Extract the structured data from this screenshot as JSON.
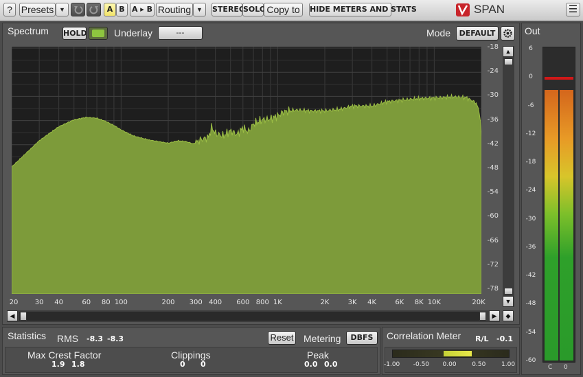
{
  "toolbar": {
    "help": "?",
    "presets": "Presets",
    "dropdown_glyph": "▼",
    "a": "A",
    "b": "B",
    "ab": "A ▸ B",
    "routing": "Routing",
    "stereo": "STEREO",
    "solo": "SOLO",
    "copy_to": "Copy to",
    "hide_meters": "HIDE METERS AND STATS",
    "logo": "SPAN",
    "menu_glyph": "☰"
  },
  "spectrum": {
    "title": "Spectrum",
    "hold": "HOLD",
    "underlay_label": "Underlay",
    "underlay_value": "---",
    "mode_label": "Mode",
    "mode_value": "DEFAULT",
    "y_ticks": [
      "-18",
      "-24",
      "-30",
      "-36",
      "-42",
      "-48",
      "-54",
      "-60",
      "-66",
      "-72",
      "-78"
    ],
    "x_ticks": [
      "20",
      "30",
      "40",
      "60",
      "80",
      "100",
      "200",
      "300",
      "400",
      "600",
      "800",
      "1K",
      "2K",
      "3K",
      "4K",
      "6K",
      "8K",
      "10K",
      "20K"
    ],
    "fill_color": "#7d9b3a"
  },
  "output": {
    "title": "Out",
    "scale": [
      "6",
      "0",
      "-6",
      "-12",
      "-18",
      "-24",
      "-30",
      "-36",
      "-42",
      "-48",
      "-54",
      "-60"
    ],
    "channels": [
      "C",
      "0"
    ],
    "peak_hold_db": 0
  },
  "statistics": {
    "title": "Statistics",
    "rms_label": "RMS",
    "rms_l": "-8.3",
    "rms_r": "-8.3",
    "reset": "Reset",
    "metering_label": "Metering",
    "metering_value": "DBFS",
    "crest_label": "Max Crest Factor",
    "crest_l": "1.9",
    "crest_r": "1.8",
    "clip_label": "Clippings",
    "clip_l": "0",
    "clip_r": "0",
    "peak_label": "Peak",
    "peak_l": "0.0",
    "peak_r": "0.0"
  },
  "correlation": {
    "title": "Correlation Meter",
    "rl_label": "R/L",
    "rl_value": "-0.1",
    "scale": [
      "-1.00",
      "-0.50",
      "0.00",
      "0.50",
      "1.00"
    ],
    "value": 0.2
  }
}
